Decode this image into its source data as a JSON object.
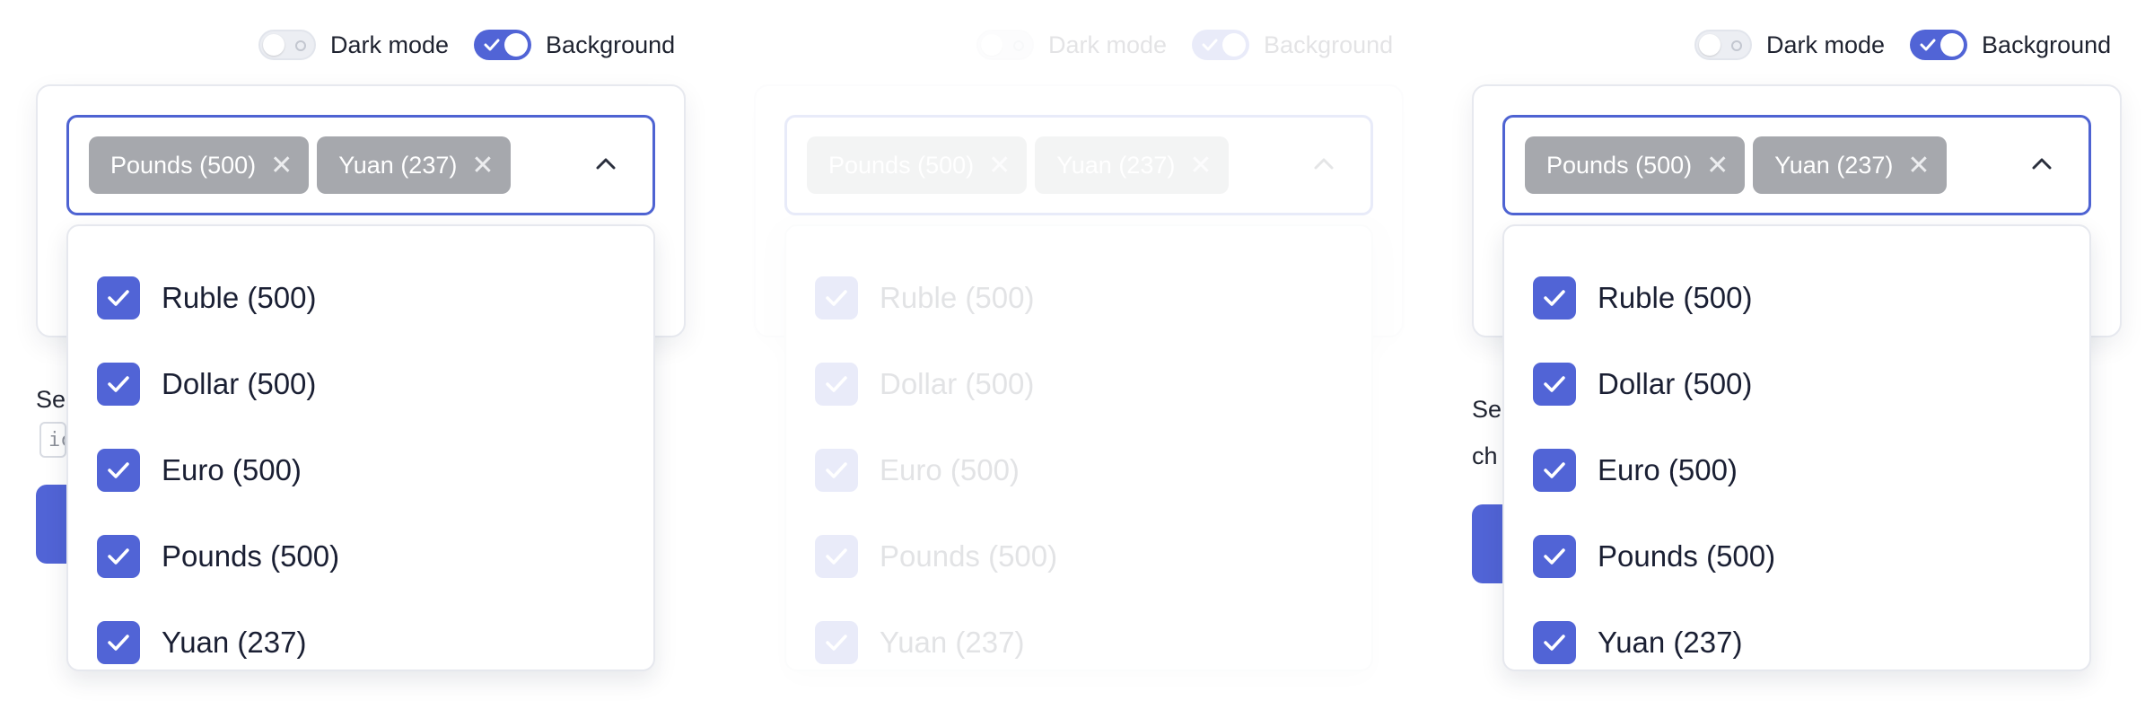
{
  "controls": {
    "dark_mode_label": "Dark mode",
    "dark_mode_on": false,
    "background_label": "Background",
    "background_on": true
  },
  "select": {
    "chips": [
      {
        "label": "Pounds (500)"
      },
      {
        "label": "Yuan (237)"
      }
    ],
    "remove_glyph": "✕",
    "options": [
      {
        "label": "Ruble (500)",
        "checked": true
      },
      {
        "label": "Dollar (500)",
        "checked": true
      },
      {
        "label": "Euro (500)",
        "checked": true
      },
      {
        "label": "Pounds (500)",
        "checked": true
      },
      {
        "label": "Yuan (237)",
        "checked": true
      }
    ]
  },
  "side": {
    "text_line1": "Se",
    "text_line2": "ch",
    "input_value": "ic"
  },
  "colors": {
    "accent": "#5164d6",
    "chip_bg": "#a6a8ad",
    "focus_border": "#4e63d2"
  }
}
